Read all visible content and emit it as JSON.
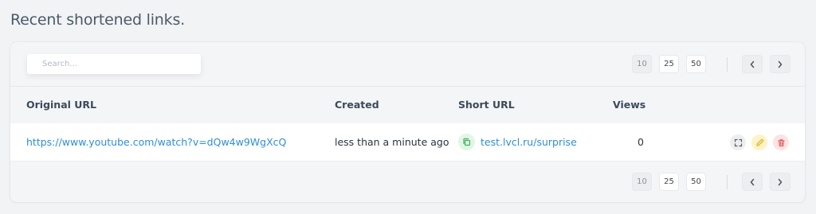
{
  "page": {
    "title": "Recent shortened links."
  },
  "search": {
    "placeholder": "Search..."
  },
  "pagination": {
    "sizes": [
      "10",
      "25",
      "50"
    ],
    "selected_size": "10"
  },
  "table": {
    "columns": [
      "Original URL",
      "Created",
      "Short URL",
      "Views"
    ],
    "rows": [
      {
        "original_url": "https://www.youtube.com/watch?v=dQw4w9WgXcQ",
        "created": "less than a minute ago",
        "short_url": "test.lvcl.ru/surprise",
        "views": "0"
      }
    ]
  },
  "icons": {
    "copy": "copy-icon",
    "expand": "expand-icon",
    "edit": "pencil-icon",
    "delete": "trash-icon",
    "prev": "chevron-left-icon",
    "next": "chevron-right-icon"
  },
  "colors": {
    "link": "#2d8fd5",
    "copy_bg": "#e2f5e6",
    "copy_fg": "#3bb55a",
    "edit_bg": "#fdf3c8",
    "edit_fg": "#e0b020",
    "delete_bg": "#fde3e3",
    "delete_fg": "#e05252"
  }
}
